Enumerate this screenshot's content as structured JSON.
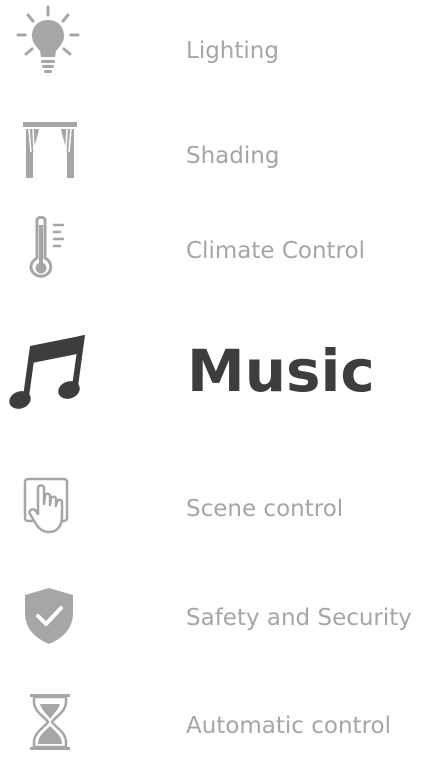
{
  "colors": {
    "inactive": "#a6a6a6",
    "active": "#3d3d3d",
    "background": "#ffffff"
  },
  "menu": {
    "active_item": "music",
    "items": [
      {
        "id": "lighting",
        "label": "Lighting",
        "icon": "lightbulb-icon"
      },
      {
        "id": "shading",
        "label": "Shading",
        "icon": "curtain-icon"
      },
      {
        "id": "climate",
        "label": "Climate Control",
        "icon": "thermometer-icon"
      },
      {
        "id": "music",
        "label": "Music",
        "icon": "music-note-icon"
      },
      {
        "id": "scene",
        "label": "Scene control",
        "icon": "touch-hand-icon"
      },
      {
        "id": "security",
        "label": "Safety and Security",
        "icon": "shield-check-icon"
      },
      {
        "id": "automatic",
        "label": "Automatic control",
        "icon": "hourglass-icon"
      }
    ]
  }
}
